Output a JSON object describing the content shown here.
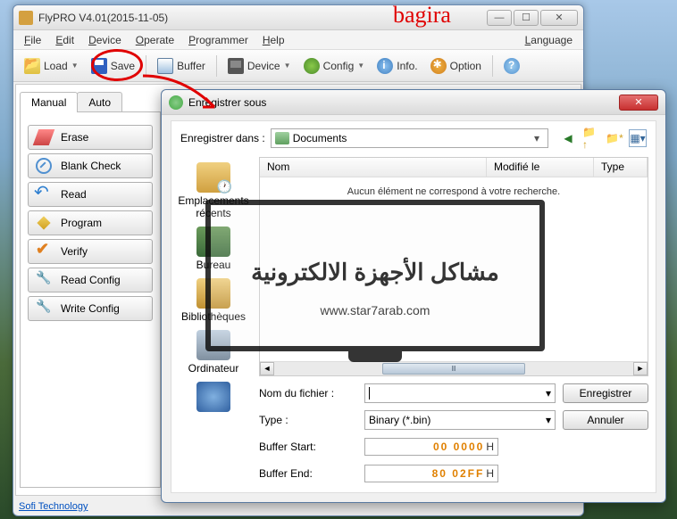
{
  "annotation": {
    "bagira": "bagira"
  },
  "main": {
    "title": "FlyPRO V4.01(2015-11-05)",
    "menus": {
      "file": "File",
      "edit": "Edit",
      "device": "Device",
      "operate": "Operate",
      "programmer": "Programmer",
      "help": "Help",
      "language": "Language"
    },
    "toolbar": {
      "load": "Load",
      "save": "Save",
      "buffer": "Buffer",
      "device": "Device",
      "config": "Config",
      "info": "Info.",
      "option": "Option"
    },
    "tabs": {
      "manual": "Manual",
      "auto": "Auto"
    },
    "ops": {
      "erase": "Erase",
      "blank": "Blank Check",
      "read": "Read",
      "program": "Program",
      "verify": "Verify",
      "rconfig": "Read Config",
      "wconfig": "Write Config"
    },
    "footer": "Sofi Technology"
  },
  "dialog": {
    "title": "Enregistrer sous",
    "save_in_label": "Enregistrer dans :",
    "save_in_value": "Documents",
    "columns": {
      "name": "Nom",
      "modified": "Modifié le",
      "type": "Type"
    },
    "empty": "Aucun élément ne correspond à votre recherche.",
    "places": {
      "recent": "Emplacements récents",
      "desktop": "Bureau",
      "libraries": "Bibliothèques",
      "computer": "Ordinateur"
    },
    "filename_label": "Nom du fichier :",
    "filename_value": "",
    "type_label": "Type :",
    "type_value": "Binary (*.bin)",
    "buffer_start_label": "Buffer Start:",
    "buffer_start_value": "00 0000",
    "buffer_end_label": "Buffer End:",
    "buffer_end_value": "80 02FF",
    "hex_suffix": "H",
    "save_btn": "Enregistrer",
    "cancel_btn": "Annuler"
  },
  "watermark": {
    "text": "مشاكل الأجهزة الالكترونية",
    "url": "www.star7arab.com"
  }
}
